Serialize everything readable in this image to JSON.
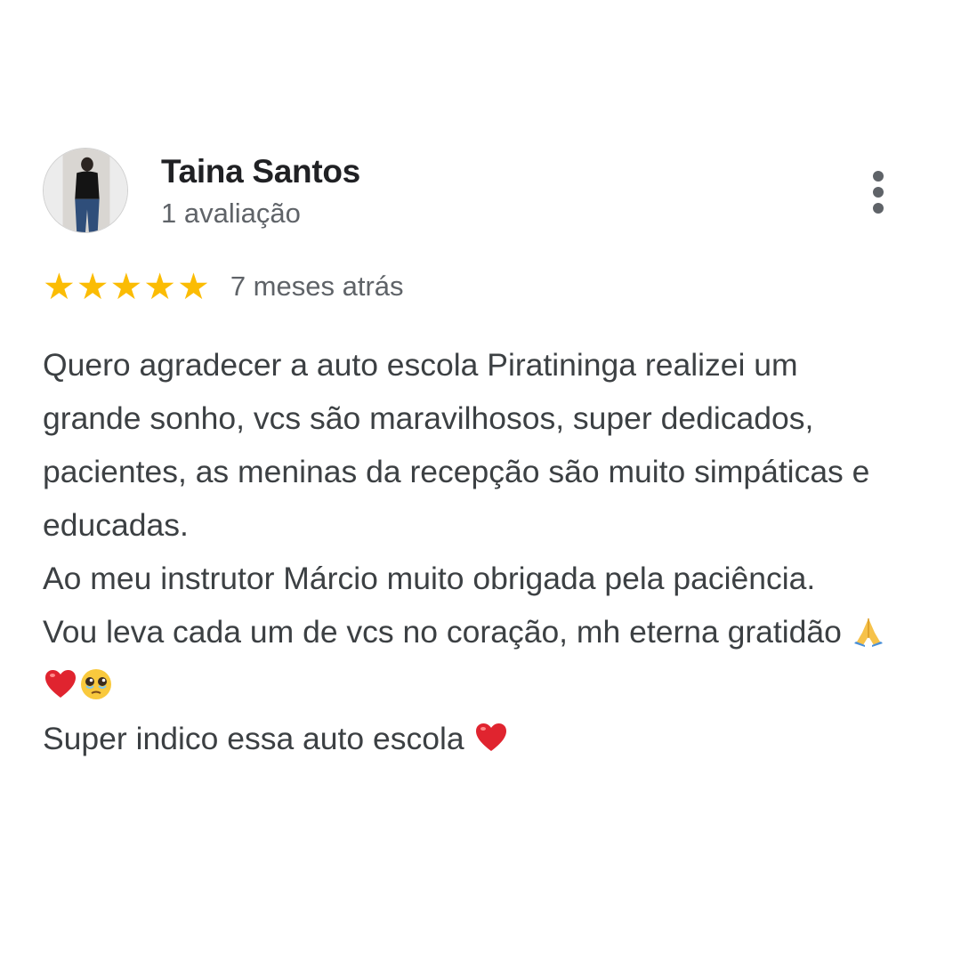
{
  "review": {
    "author_name": "Taina Santos",
    "author_meta": "1 avaliação",
    "rating": 5,
    "rating_max": 5,
    "star_color": "#fbbc04",
    "date": "7 meses atrás",
    "text_lines": [
      "Quero agradecer a auto escola Piratininga realizei um grande sonho, vcs são maravilhosos, super dedicados, pacientes, as meninas da recepção são muito simpáticas e educadas.",
      "Ao meu instrutor Márcio muito obrigada pela paciência.",
      "Vou leva cada um de vcs no coração, mh eterna gratidão",
      "Super indico essa auto escola"
    ],
    "line3_emojis": [
      "folded-hands-icon",
      "red-heart-icon",
      "teary-face-icon"
    ],
    "line4_emojis": [
      "red-heart-icon"
    ]
  },
  "icons": {
    "more": "more-vertical-icon",
    "star": "star-icon"
  }
}
